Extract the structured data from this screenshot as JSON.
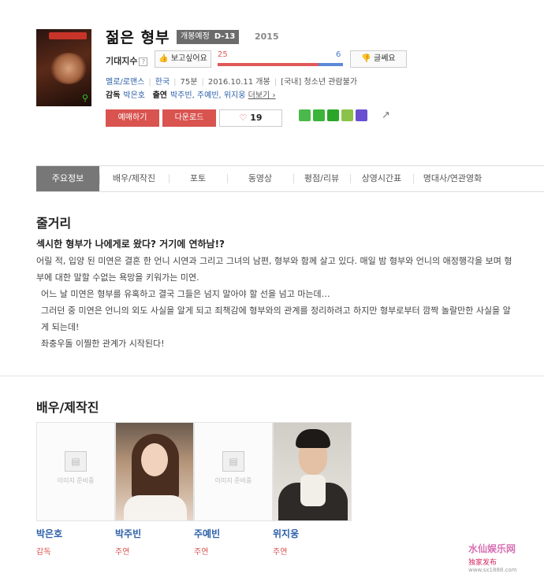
{
  "movie": {
    "title": "젊은 형부",
    "status_badge": "개봉예정",
    "dday": "D-13",
    "year": "2015"
  },
  "anticipation": {
    "label": "기대지수",
    "like_label": "보고싶어요",
    "dislike_label": "글쎄요",
    "like_count": "25",
    "dislike_count": "6",
    "like_ratio": 0.806
  },
  "info": {
    "genre": "멜로/로맨스",
    "country": "한국",
    "runtime": "75분",
    "release": "2016.10.11 개봉",
    "rating": "[국내] 청소년 관람불가"
  },
  "credits": {
    "director_label": "감독",
    "director": "박은호",
    "cast_label": "출연",
    "cast": "박주빈, 주예빈, 위지웅",
    "more": "더보기"
  },
  "actions": {
    "reserve": "예매하기",
    "download": "다운로드",
    "likes": "19"
  },
  "share_colors": [
    "#4bb84a",
    "#3cb43c",
    "#2aa52a",
    "#8bc34a",
    "#6a4fd0"
  ],
  "tabs": [
    "주요정보",
    "배우/제작진",
    "포토",
    "동영상",
    "평점/리뷰",
    "상영시간표",
    "명대사/연관영화"
  ],
  "synopsis": {
    "heading": "줄거리",
    "tagline": "섹시한 형부가 나에게로 왔다? 거기에 연하남!?",
    "p1": "어릴 적, 입양 된 미연은 결혼 한 언니 시연과 그리고 그녀의 남편, 형부와 함께 살고 있다. 매일 밤 형부와 언니의 애정행각을 보며 형부에 대한 말할 수없는 욕망을 키워가는 미연.",
    "p2": "어느 날 미연은 형부를 유혹하고 결국 그들은 넘지 말아야 할 선을 넘고 마는데…",
    "p3": "그러던 중 미연은 언니의 외도 사실을 알게 되고 죄책감에 형부와의 관계를 정리하려고 하지만 형부로부터 깜짝 놀랄만한 사실을 알게 되는데!",
    "p4": "좌충우돌 이찔한 관계가 시작된다!"
  },
  "cast_section": {
    "heading": "배우/제작진",
    "no_image": "이미지 준비중",
    "people": [
      {
        "name": "박은호",
        "role": "감독"
      },
      {
        "name": "박주빈",
        "role": "주연"
      },
      {
        "name": "주예빈",
        "role": "주연"
      },
      {
        "name": "위지웅",
        "role": "주연"
      }
    ]
  },
  "watermark": {
    "line1": "水仙娱乐网",
    "line2": "独家发布",
    "line3": "www.sx1888.com"
  },
  "colors": {
    "accent_red": "#d9534f",
    "link_blue": "#2b5fa8",
    "tab_active": "#777777"
  }
}
